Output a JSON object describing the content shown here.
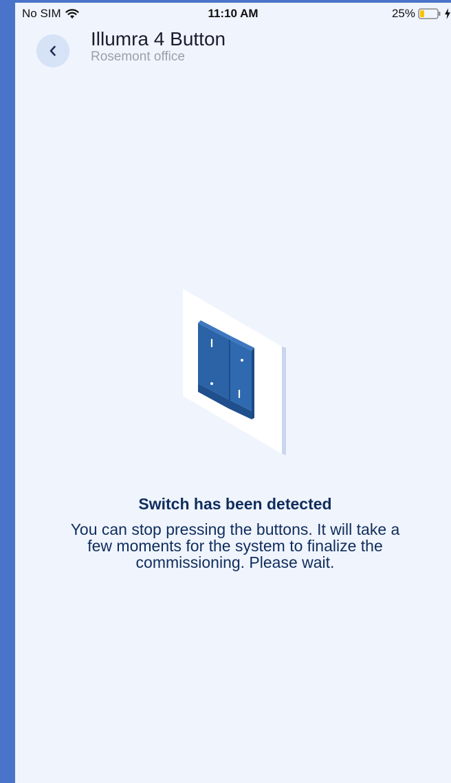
{
  "status_bar": {
    "carrier": "No SIM",
    "time": "11:10 AM",
    "battery_percent": "25%",
    "battery_level": 0.25
  },
  "header": {
    "title": "Illumra 4 Button",
    "subtitle": "Rosemont office",
    "back_icon": "chevron-left-icon"
  },
  "illustration": {
    "icon": "wall-switch-icon",
    "switch_color": "#2b63a6",
    "plate_color": "#ffffff"
  },
  "message": {
    "title": "Switch has been detected",
    "body": "You can stop pressing the buttons. It will take a few moments for the system to finalize the commissioning. Please wait."
  },
  "colors": {
    "background": "#f0f4fd",
    "frame": "#4a74c9",
    "accent": "#0f2d5c",
    "back_button_bg": "#d6e2f6"
  }
}
